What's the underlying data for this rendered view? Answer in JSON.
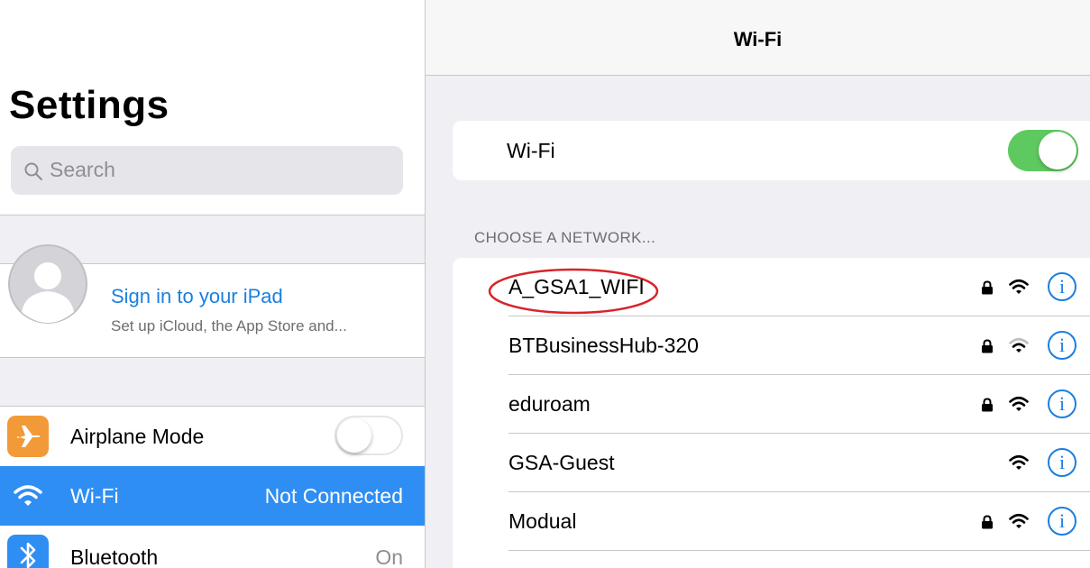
{
  "left_pane": {
    "title": "Settings",
    "search": {
      "placeholder": "Search",
      "icon": "search-icon"
    },
    "profile": {
      "title": "Sign in to your iPad",
      "subtitle": "Set up iCloud, the App Store and..."
    },
    "items": [
      {
        "label": "Airplane Mode",
        "value": "",
        "icon": "airplane-icon",
        "icon_color": "#f19a37",
        "toggle": "off"
      },
      {
        "label": "Wi-Fi",
        "value": "Not Connected",
        "icon": "wifi-icon",
        "icon_color": "#2f8ef3",
        "selected": true
      },
      {
        "label": "Bluetooth",
        "value": "On",
        "icon": "bluetooth-icon",
        "icon_color": "#2f8ef3"
      }
    ]
  },
  "right_pane": {
    "nav_title": "Wi-Fi",
    "wifi_switch": {
      "label": "Wi-Fi",
      "state": "on"
    },
    "section_header": "CHOOSE A NETWORK...",
    "networks": [
      {
        "name": "A_GSA1_WIFI",
        "locked": true,
        "signal": "full",
        "highlighted": true
      },
      {
        "name": "BTBusinessHub-320",
        "locked": true,
        "signal": "weak"
      },
      {
        "name": "eduroam",
        "locked": true,
        "signal": "full"
      },
      {
        "name": "GSA-Guest",
        "locked": false,
        "signal": "full"
      },
      {
        "name": "Modual",
        "locked": true,
        "signal": "full"
      }
    ]
  },
  "colors": {
    "accent_blue": "#1a7fdf",
    "selected_row": "#2f8ef3",
    "toggle_on": "#5ec95f",
    "highlight_ellipse": "#d9232a"
  }
}
